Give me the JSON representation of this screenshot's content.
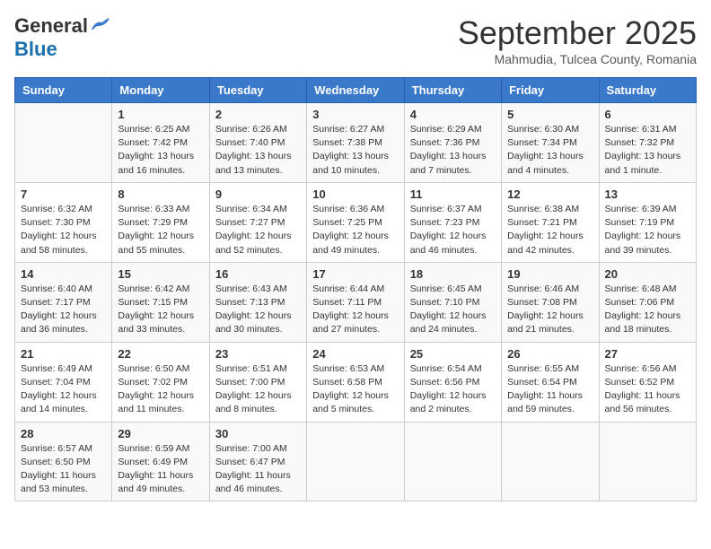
{
  "header": {
    "logo_general": "General",
    "logo_blue": "Blue",
    "month": "September 2025",
    "location": "Mahmudia, Tulcea County, Romania"
  },
  "days_of_week": [
    "Sunday",
    "Monday",
    "Tuesday",
    "Wednesday",
    "Thursday",
    "Friday",
    "Saturday"
  ],
  "weeks": [
    [
      {
        "day": "",
        "info": ""
      },
      {
        "day": "1",
        "info": "Sunrise: 6:25 AM\nSunset: 7:42 PM\nDaylight: 13 hours\nand 16 minutes."
      },
      {
        "day": "2",
        "info": "Sunrise: 6:26 AM\nSunset: 7:40 PM\nDaylight: 13 hours\nand 13 minutes."
      },
      {
        "day": "3",
        "info": "Sunrise: 6:27 AM\nSunset: 7:38 PM\nDaylight: 13 hours\nand 10 minutes."
      },
      {
        "day": "4",
        "info": "Sunrise: 6:29 AM\nSunset: 7:36 PM\nDaylight: 13 hours\nand 7 minutes."
      },
      {
        "day": "5",
        "info": "Sunrise: 6:30 AM\nSunset: 7:34 PM\nDaylight: 13 hours\nand 4 minutes."
      },
      {
        "day": "6",
        "info": "Sunrise: 6:31 AM\nSunset: 7:32 PM\nDaylight: 13 hours\nand 1 minute."
      }
    ],
    [
      {
        "day": "7",
        "info": "Sunrise: 6:32 AM\nSunset: 7:30 PM\nDaylight: 12 hours\nand 58 minutes."
      },
      {
        "day": "8",
        "info": "Sunrise: 6:33 AM\nSunset: 7:29 PM\nDaylight: 12 hours\nand 55 minutes."
      },
      {
        "day": "9",
        "info": "Sunrise: 6:34 AM\nSunset: 7:27 PM\nDaylight: 12 hours\nand 52 minutes."
      },
      {
        "day": "10",
        "info": "Sunrise: 6:36 AM\nSunset: 7:25 PM\nDaylight: 12 hours\nand 49 minutes."
      },
      {
        "day": "11",
        "info": "Sunrise: 6:37 AM\nSunset: 7:23 PM\nDaylight: 12 hours\nand 46 minutes."
      },
      {
        "day": "12",
        "info": "Sunrise: 6:38 AM\nSunset: 7:21 PM\nDaylight: 12 hours\nand 42 minutes."
      },
      {
        "day": "13",
        "info": "Sunrise: 6:39 AM\nSunset: 7:19 PM\nDaylight: 12 hours\nand 39 minutes."
      }
    ],
    [
      {
        "day": "14",
        "info": "Sunrise: 6:40 AM\nSunset: 7:17 PM\nDaylight: 12 hours\nand 36 minutes."
      },
      {
        "day": "15",
        "info": "Sunrise: 6:42 AM\nSunset: 7:15 PM\nDaylight: 12 hours\nand 33 minutes."
      },
      {
        "day": "16",
        "info": "Sunrise: 6:43 AM\nSunset: 7:13 PM\nDaylight: 12 hours\nand 30 minutes."
      },
      {
        "day": "17",
        "info": "Sunrise: 6:44 AM\nSunset: 7:11 PM\nDaylight: 12 hours\nand 27 minutes."
      },
      {
        "day": "18",
        "info": "Sunrise: 6:45 AM\nSunset: 7:10 PM\nDaylight: 12 hours\nand 24 minutes."
      },
      {
        "day": "19",
        "info": "Sunrise: 6:46 AM\nSunset: 7:08 PM\nDaylight: 12 hours\nand 21 minutes."
      },
      {
        "day": "20",
        "info": "Sunrise: 6:48 AM\nSunset: 7:06 PM\nDaylight: 12 hours\nand 18 minutes."
      }
    ],
    [
      {
        "day": "21",
        "info": "Sunrise: 6:49 AM\nSunset: 7:04 PM\nDaylight: 12 hours\nand 14 minutes."
      },
      {
        "day": "22",
        "info": "Sunrise: 6:50 AM\nSunset: 7:02 PM\nDaylight: 12 hours\nand 11 minutes."
      },
      {
        "day": "23",
        "info": "Sunrise: 6:51 AM\nSunset: 7:00 PM\nDaylight: 12 hours\nand 8 minutes."
      },
      {
        "day": "24",
        "info": "Sunrise: 6:53 AM\nSunset: 6:58 PM\nDaylight: 12 hours\nand 5 minutes."
      },
      {
        "day": "25",
        "info": "Sunrise: 6:54 AM\nSunset: 6:56 PM\nDaylight: 12 hours\nand 2 minutes."
      },
      {
        "day": "26",
        "info": "Sunrise: 6:55 AM\nSunset: 6:54 PM\nDaylight: 11 hours\nand 59 minutes."
      },
      {
        "day": "27",
        "info": "Sunrise: 6:56 AM\nSunset: 6:52 PM\nDaylight: 11 hours\nand 56 minutes."
      }
    ],
    [
      {
        "day": "28",
        "info": "Sunrise: 6:57 AM\nSunset: 6:50 PM\nDaylight: 11 hours\nand 53 minutes."
      },
      {
        "day": "29",
        "info": "Sunrise: 6:59 AM\nSunset: 6:49 PM\nDaylight: 11 hours\nand 49 minutes."
      },
      {
        "day": "30",
        "info": "Sunrise: 7:00 AM\nSunset: 6:47 PM\nDaylight: 11 hours\nand 46 minutes."
      },
      {
        "day": "",
        "info": ""
      },
      {
        "day": "",
        "info": ""
      },
      {
        "day": "",
        "info": ""
      },
      {
        "day": "",
        "info": ""
      }
    ]
  ]
}
